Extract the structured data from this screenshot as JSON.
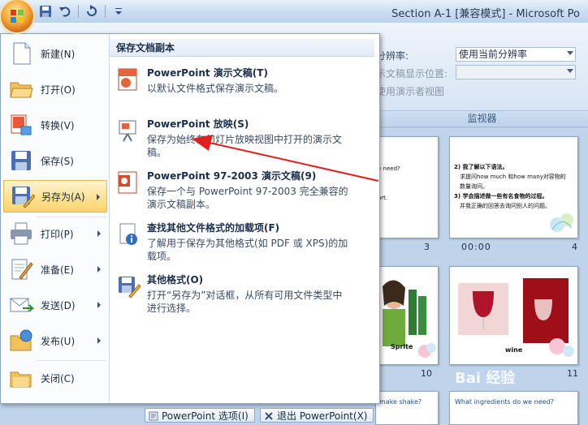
{
  "window": {
    "title": "Section A-1 [兼容模式] - Microsoft Po"
  },
  "quick_access": {
    "icons": [
      "save-icon",
      "undo-icon",
      "redo-icon",
      "customize-icon"
    ]
  },
  "ribbon": {
    "resolution_label": "分辨率:",
    "resolution_value": "使用当前分辨率",
    "show_on_label": "示文稿显示位置:",
    "presenter_view_label": "使用演示者视图",
    "group_label": "监视器"
  },
  "office_menu": {
    "items": [
      {
        "label": "新建(N)",
        "icon": "new-doc-icon",
        "has_submenu": false
      },
      {
        "label": "打开(O)",
        "icon": "open-folder-icon",
        "has_submenu": false
      },
      {
        "label": "转换(V)",
        "icon": "convert-icon",
        "has_submenu": false
      },
      {
        "label": "保存(S)",
        "icon": "save-disk-icon",
        "has_submenu": false
      },
      {
        "label": "另存为(A)",
        "icon": "save-as-icon",
        "has_submenu": true,
        "selected": true
      },
      {
        "label": "打印(P)",
        "icon": "printer-icon",
        "has_submenu": true
      },
      {
        "label": "准备(E)",
        "icon": "prepare-icon",
        "has_submenu": true
      },
      {
        "label": "发送(D)",
        "icon": "send-icon",
        "has_submenu": true
      },
      {
        "label": "发布(U)",
        "icon": "publish-icon",
        "has_submenu": true
      },
      {
        "label": "关闭(C)",
        "icon": "close-folder-icon",
        "has_submenu": false
      }
    ],
    "submenu": {
      "title": "保存文档副本",
      "items": [
        {
          "title": "PowerPoint 演示文稿(T)",
          "desc": "以默认文件格式保存演示文稿。",
          "icon": "pptx-icon"
        },
        {
          "title": "PowerPoint 放映(S)",
          "desc": "保存为始终在幻灯片放映视图中打开的演示文稿。",
          "icon": "slideshow-icon"
        },
        {
          "title": "PowerPoint 97-2003 演示文稿(9)",
          "desc": "保存一个与 PowerPoint 97-2003 完全兼容的演示文稿副本。",
          "icon": "ppt97-icon"
        },
        {
          "title": "查找其他文件格式的加载项(F)",
          "desc": "了解用于保存为其他格式(如 PDF 或 XPS)的加载项。",
          "icon": "info-icon"
        },
        {
          "title": "其他格式(O)",
          "desc": "打开“另存为”对话框，从所有可用文件类型中进行选择。",
          "icon": "other-format-icon"
        }
      ]
    },
    "options_button": "PowerPoint 选项(I)",
    "exit_button": "退出 PowerPoint(X)"
  },
  "slides": {
    "top_row": [
      {
        "number": "3",
        "time": "",
        "lines": [
          "e need?",
          "",
          "",
          "",
          "art."
        ]
      },
      {
        "number": "4",
        "time": "00:00",
        "lines": [
          "2) 我了解以下语法。",
          "求提问how much 和how many对容物的",
          "数量询问。",
          "3) 学会描述做一些有名食物的过程。",
          "并我正确的回答去询问别人的问题。"
        ]
      }
    ],
    "mid_row": [
      {
        "number": "10",
        "caption": "Sprite"
      },
      {
        "number": "11",
        "caption": "wine"
      }
    ],
    "bottom_row": [
      {
        "title": "make shake?"
      },
      {
        "title": "What ingredients do we need?"
      }
    ]
  },
  "watermark": "Bai 经验"
}
